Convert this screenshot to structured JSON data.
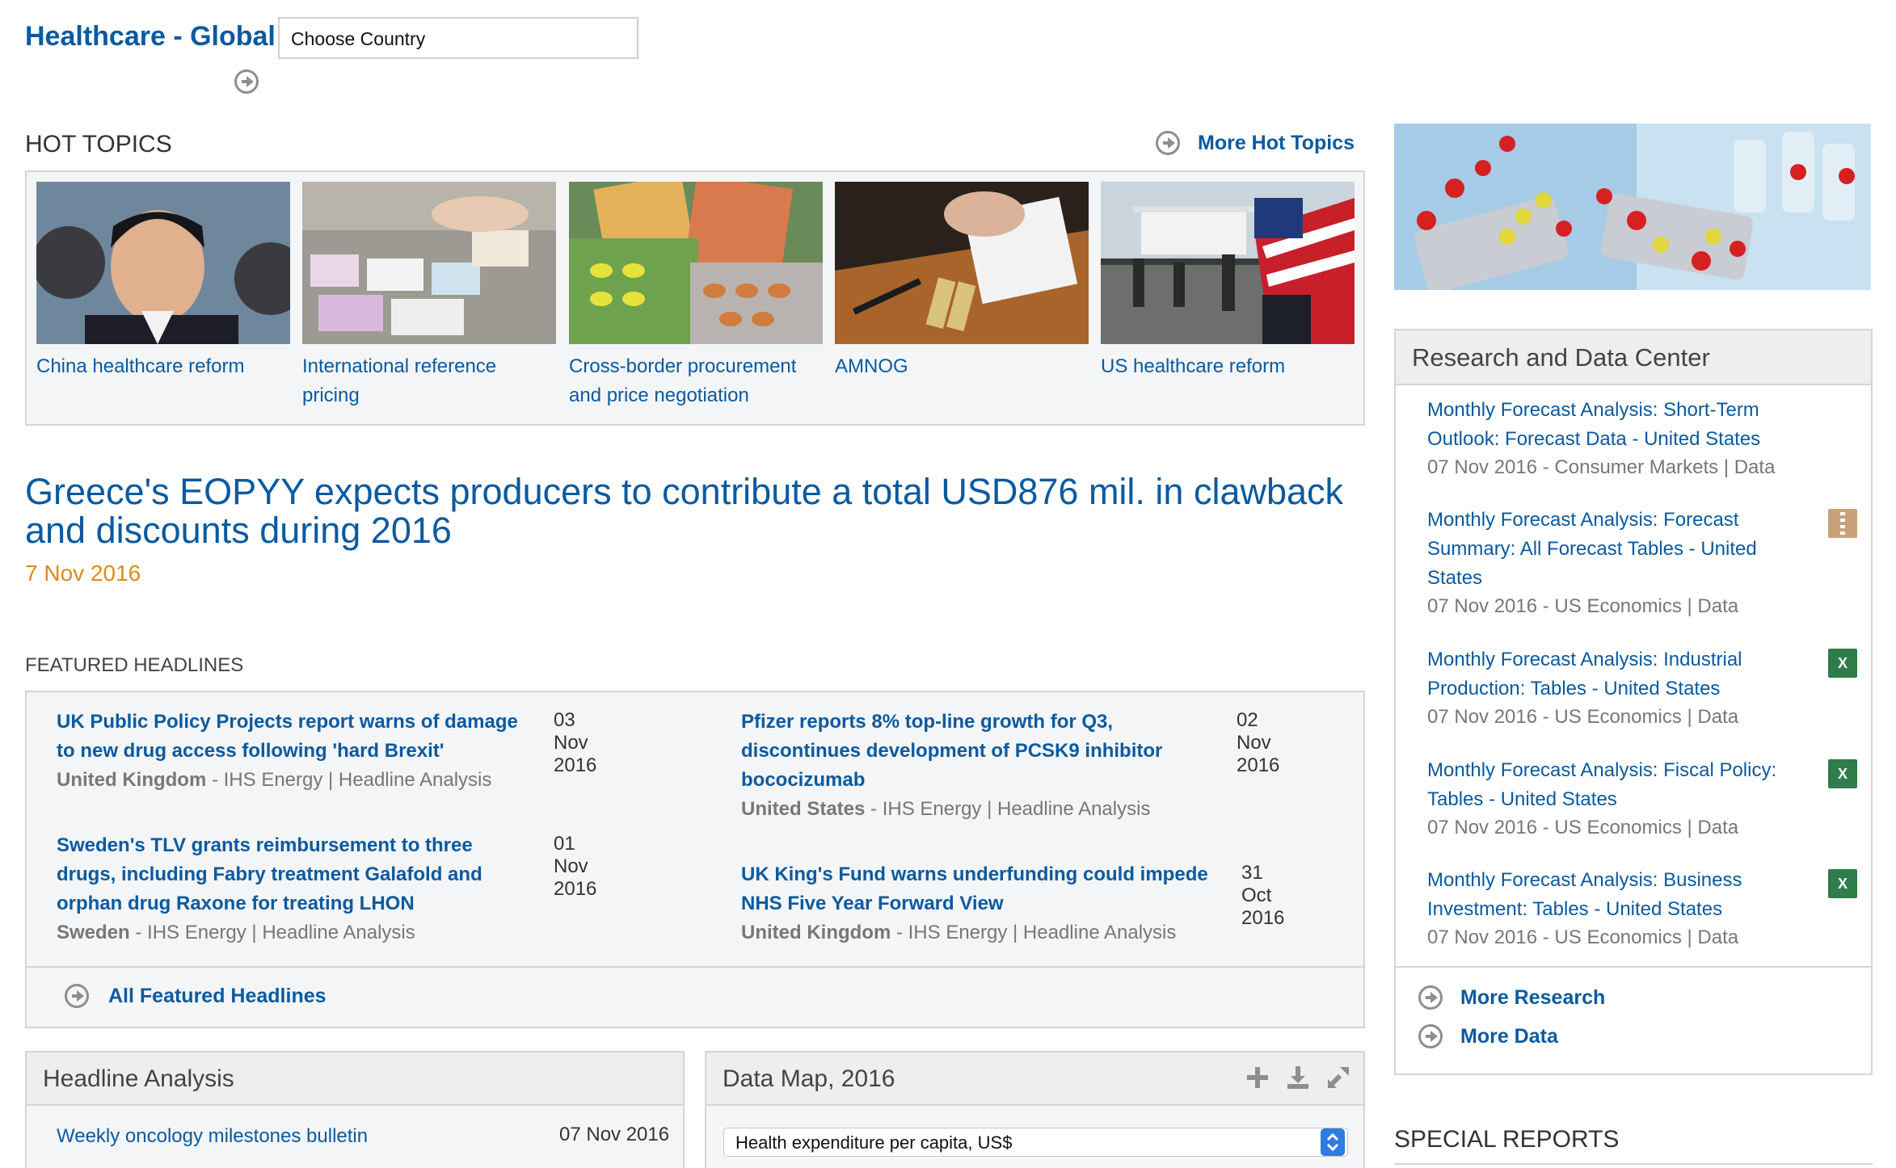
{
  "header": {
    "title": "Healthcare - Global",
    "country_select": "Choose Country"
  },
  "hot_topics": {
    "title": "HOT TOPICS",
    "more_link": "More Hot Topics",
    "items": [
      {
        "label": "China healthcare reform"
      },
      {
        "label": "International reference pricing"
      },
      {
        "label": "Cross-border procurement and price negotiation"
      },
      {
        "label": "AMNOG"
      },
      {
        "label": "US healthcare reform"
      }
    ]
  },
  "lead_story": {
    "title": "Greece's EOPYY expects producers to contribute a total USD876 mil. in clawback and discounts during 2016",
    "date": "7 Nov 2016"
  },
  "featured_headlines": {
    "title": "FEATURED HEADLINES",
    "items": [
      {
        "title": "UK Public Policy Projects report warns of damage to new drug access following 'hard Brexit'",
        "country": "United Kingdom",
        "source": " - IHS Energy | Headline Analysis",
        "date": "03 Nov 2016"
      },
      {
        "title": "Pfizer reports 8% top-line growth for Q3, discontinues development of PCSK9 inhibitor bococizumab",
        "country": "United States",
        "source": " - IHS Energy | Headline Analysis",
        "date": "02 Nov 2016"
      },
      {
        "title": "Sweden's TLV grants reimbursement to three drugs, including Fabry treatment Galafold and orphan drug Raxone for treating LHON",
        "country": "Sweden",
        "source": " - IHS Energy | Headline Analysis",
        "date": "01 Nov 2016"
      },
      {
        "title": "UK King's Fund warns underfunding could impede NHS Five Year Forward View",
        "country": "United Kingdom",
        "source": " - IHS Energy | Headline Analysis",
        "date": "31 Oct 2016"
      }
    ],
    "all_link": "All Featured Headlines"
  },
  "headline_analysis": {
    "title": "Headline Analysis",
    "items": [
      {
        "title": "Weekly oncology milestones bulletin",
        "date": "07 Nov 2016"
      }
    ]
  },
  "data_map": {
    "title": "Data Map, 2016",
    "selected": "Health expenditure per capita, US$",
    "tools": [
      "plus-icon",
      "download-icon",
      "expand-icon"
    ]
  },
  "research_center": {
    "title": "Research and Data Center",
    "items": [
      {
        "title": "Monthly Forecast Analysis: Short-Term Outlook: Forecast Data - United States",
        "meta": "07 Nov 2016 - Consumer Markets | Data",
        "file": "none"
      },
      {
        "title": "Monthly Forecast Analysis: Forecast Summary: All Forecast Tables - United States",
        "meta": "07 Nov 2016 - US Economics | Data",
        "file": "zip-icon"
      },
      {
        "title": "Monthly Forecast Analysis: Industrial Production: Tables - United States",
        "meta": "07 Nov 2016 - US Economics | Data",
        "file": "excel-icon"
      },
      {
        "title": "Monthly Forecast Analysis: Fiscal Policy: Tables - United States",
        "meta": "07 Nov 2016 - US Economics | Data",
        "file": "excel-icon"
      },
      {
        "title": "Monthly Forecast Analysis: Business Investment: Tables - United States",
        "meta": "07 Nov 2016 - US Economics | Data",
        "file": "excel-icon"
      }
    ],
    "more_research": "More Research",
    "more_data": "More Data",
    "excel_glyph": "X"
  },
  "special_reports": {
    "title": "SPECIAL REPORTS"
  }
}
